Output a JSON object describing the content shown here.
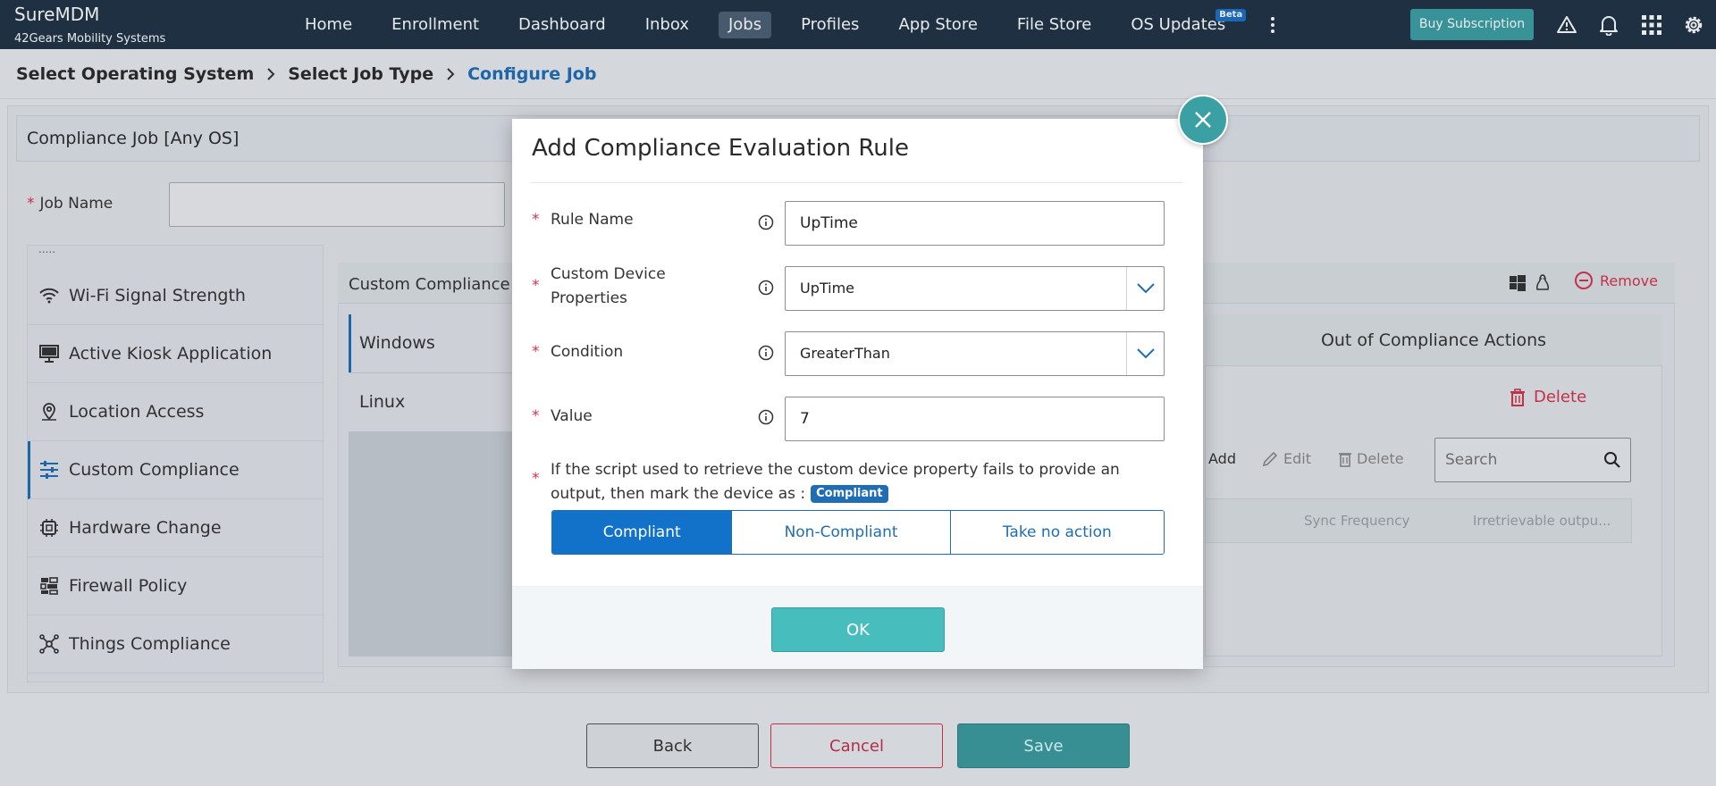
{
  "app": {
    "name": "SureMDM",
    "company": "42Gears Mobility Systems"
  },
  "nav": {
    "items": [
      "Home",
      "Enrollment",
      "Dashboard",
      "Inbox",
      "Jobs",
      "Profiles",
      "App Store",
      "File Store",
      "OS Updates"
    ],
    "active": "Jobs",
    "beta_label": "Beta",
    "buy_label": "Buy Subscription",
    "icons": [
      "more-vertical-icon",
      "warning-icon",
      "bell-icon",
      "apps-grid-icon",
      "gear-icon"
    ]
  },
  "breadcrumb": [
    "Select Operating System",
    "Select Job Type",
    "Configure Job"
  ],
  "job": {
    "title": "Compliance Job [Any OS]",
    "name_label": "Job Name",
    "name_value": ""
  },
  "left_menu": {
    "items": [
      "Wi-Fi Signal Strength",
      "Active Kiosk Application",
      "Location Access",
      "Custom Compliance",
      "Hardware Change",
      "Firewall Policy",
      "Things Compliance"
    ],
    "active": "Custom Compliance"
  },
  "custom_panel": {
    "title": "Custom Compliance",
    "remove_label": "Remove",
    "os_items": [
      "Windows",
      "Linux"
    ],
    "ooc_title": "Out of Compliance Actions",
    "delete_label": "Delete",
    "toolbar": {
      "add": "Add",
      "edit": "Edit",
      "delete": "Delete"
    },
    "search_placeholder": "Search",
    "columns": [
      "Sync Frequency",
      "Irretrievable outpu..."
    ]
  },
  "footer_buttons": {
    "back": "Back",
    "cancel": "Cancel",
    "save": "Save"
  },
  "modal": {
    "title": "Add Compliance Evaluation Rule",
    "rule_name_label": "Rule Name",
    "rule_name_value": "UpTime",
    "property_label_line1": "Custom Device",
    "property_label_line2": "Properties",
    "property_value": "UpTime",
    "condition_label": "Condition",
    "condition_value": "GreaterThan",
    "value_label": "Value",
    "value_value": "7",
    "fail_text": "If the script used to retrieve the custom device property fails to provide an output, then mark the device as :",
    "fail_badge": "Compliant",
    "options": [
      "Compliant",
      "Non-Compliant",
      "Take no action"
    ],
    "selected_option": "Compliant",
    "ok_label": "OK"
  },
  "colors": {
    "accent": "#1f6eb4",
    "teal": "#3ba0a4",
    "danger": "#d6334b",
    "navbar": "#1f3243"
  }
}
